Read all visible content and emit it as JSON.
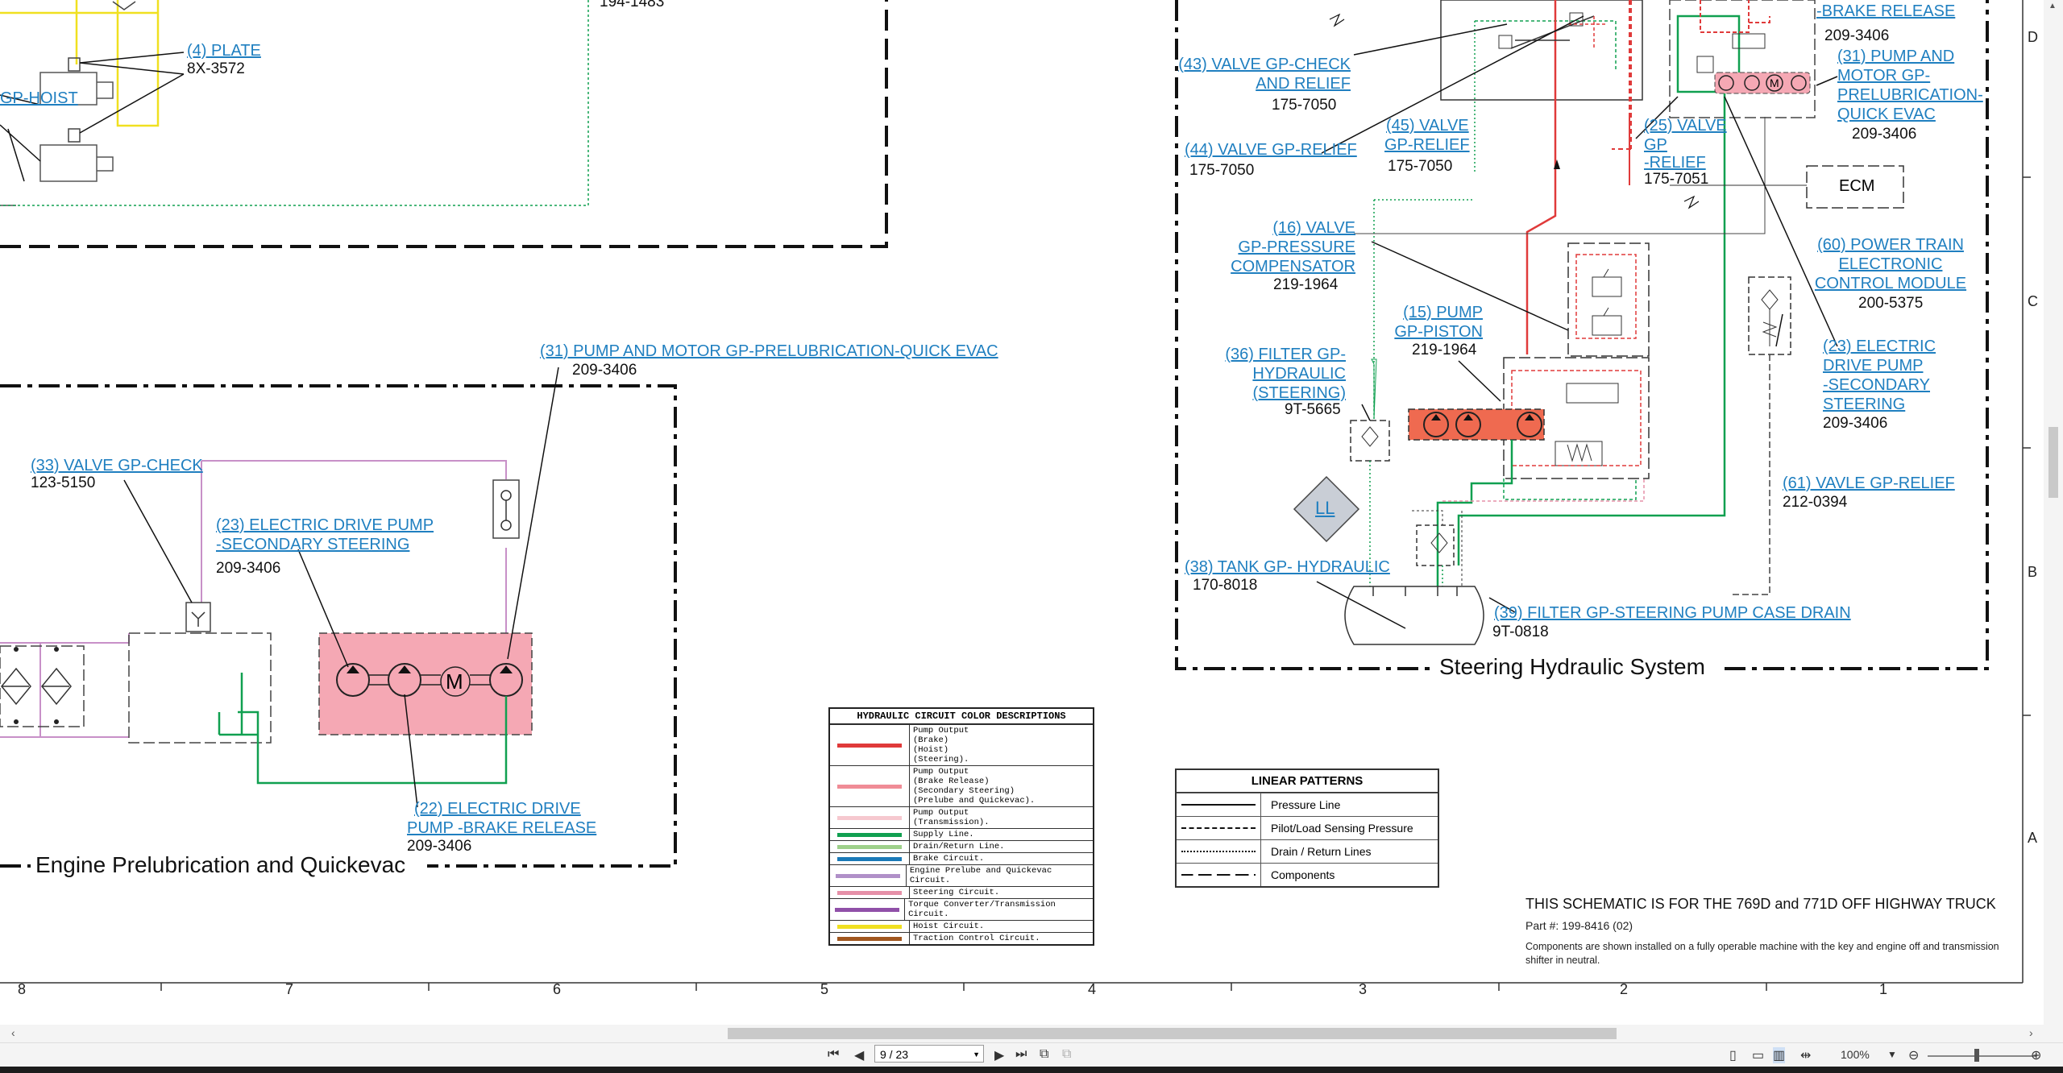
{
  "labels": {
    "plate": {
      "link": "(4) PLATE",
      "pn": "8X-3572"
    },
    "top_pn": "194-1483",
    "gp_hoist": "GP-HOIST",
    "pump_motor_quickevac": {
      "link": "(31) PUMP AND MOTOR GP-PRELUBRICATION-QUICK EVAC",
      "pn": "209-3406"
    },
    "valve_check_33": {
      "link": "(33) VALVE GP-CHECK",
      "pn": "123-5150"
    },
    "edp_secondary_23": {
      "link1": "(23) ELECTRIC DRIVE PUMP",
      "link2": "-SECONDARY STEERING",
      "pn": "209-3406"
    },
    "edp_brake_22": {
      "link1": "(22) ELECTRIC DRIVE",
      "link2": "PUMP -BRAKE RELEASE",
      "pn": "209-3406"
    },
    "valve_check_relief_43": {
      "link1": "(43) VALVE GP-CHECK",
      "link2": "AND RELIEF",
      "pn": "175-7050"
    },
    "valve_relief_44": {
      "link": "(44) VALVE GP-RELIEF",
      "pn": "175-7050"
    },
    "valve_relief_45": {
      "link1": "(45) VALVE",
      "link2": "GP-RELIEF",
      "pn": "175-7050"
    },
    "valve_relief_25": {
      "link1": "(25) VALVE",
      "link2": "GP",
      "link3": "-RELIEF",
      "pn": "175-7051"
    },
    "brake_release": {
      "link": "-BRAKE RELEASE",
      "pn": "209-3406"
    },
    "pump_motor_31r": {
      "link1": "(31) PUMP AND",
      "link2": "MOTOR GP-",
      "link3": "PRELUBRICATION-",
      "link4": "QUICK EVAC",
      "pn": "209-3406"
    },
    "ecm": "ECM",
    "ptecm_60": {
      "link1": "(60) POWER TRAIN",
      "link2": "ELECTRONIC",
      "link3": "CONTROL MODULE",
      "pn": "200-5375"
    },
    "pressure_comp_16": {
      "link1": "(16) VALVE",
      "link2": "GP-PRESSURE",
      "link3": "COMPENSATOR",
      "pn": "219-1964"
    },
    "pump_piston_15": {
      "link1": "(15) PUMP",
      "link2": "GP-PISTON",
      "pn": "219-1964"
    },
    "filter_36": {
      "link1": "(36) FILTER GP-",
      "link2": "HYDRAULIC",
      "link3": "(STEERING)",
      "pn": "9T-5665"
    },
    "edp_secondary_23r": {
      "link1": "(23) ELECTRIC",
      "link2": "DRIVE PUMP",
      "link3": "-SECONDARY",
      "link4": "STEERING",
      "pn": "209-3406"
    },
    "valve_relief_61": {
      "link": "(61) VAVLE GP-RELIEF",
      "pn": "212-0394"
    },
    "tank_38": {
      "link": "(38) TANK GP- HYDRAULIC",
      "pn": "170-8018"
    },
    "filter_39": {
      "link": "(39) FILTER GP-STEERING PUMP CASE DRAIN",
      "pn": "9T-0818"
    },
    "ll": "LL",
    "motor_m": "M"
  },
  "sections": {
    "engine_prelube": "Engine Prelubrication and Quickevac",
    "steering": "Steering Hydraulic System"
  },
  "color_legend": {
    "title": "HYDRAULIC CIRCUIT COLOR DESCRIPTIONS",
    "rows": [
      {
        "color": "#e03a3a",
        "text": "Pump Output\n(Brake)\n(Hoist)\n(Steering)."
      },
      {
        "color": "#f08c96",
        "text": "Pump Output\n(Brake Release)\n(Secondary Steering)\n(Prelube and Quickevac)."
      },
      {
        "color": "#f6c8cf",
        "text": "Pump Output\n(Transmission)."
      },
      {
        "color": "#10a050",
        "text": "Supply Line."
      },
      {
        "color": "#9ed08a",
        "text": "Drain/Return Line."
      },
      {
        "color": "#1a7ab8",
        "text": "Brake Circuit."
      },
      {
        "color": "#b090c8",
        "text": "Engine Prelube and Quickevac Circuit."
      },
      {
        "color": "#e690a8",
        "text": "Steering Circuit."
      },
      {
        "color": "#9050a8",
        "text": "Torque Converter/Transmission Circuit."
      },
      {
        "color": "#f0e020",
        "text": "Hoist Circuit."
      },
      {
        "color": "#a0561e",
        "text": "Traction Control Circuit."
      }
    ]
  },
  "linear_legend": {
    "title": "LINEAR PATTERNS",
    "rows": [
      {
        "style": "solid",
        "text": "Pressure Line"
      },
      {
        "style": "dashed",
        "text": "Pilot/Load Sensing Pressure"
      },
      {
        "style": "dotted",
        "text": "Drain / Return Lines"
      },
      {
        "style": "longdash",
        "text": "Components"
      }
    ]
  },
  "note": {
    "heading": "THIS SCHEMATIC IS FOR THE 769D and 771D OFF HIGHWAY TRUCK",
    "part": "Part #: 199-8416 (02)",
    "desc": "Components are shown installed on a fully operable machine with the key and engine off and transmission shifter in neutral."
  },
  "grid": {
    "columns": [
      "8",
      "7",
      "6",
      "5",
      "4",
      "3",
      "2",
      "1"
    ],
    "rows": [
      "D",
      "C",
      "B",
      "A"
    ]
  },
  "viewer": {
    "page": "9 / 23",
    "zoom": "100%",
    "icons": [
      "first-page-icon",
      "prev-page-icon",
      "next-page-icon",
      "last-page-icon"
    ]
  }
}
